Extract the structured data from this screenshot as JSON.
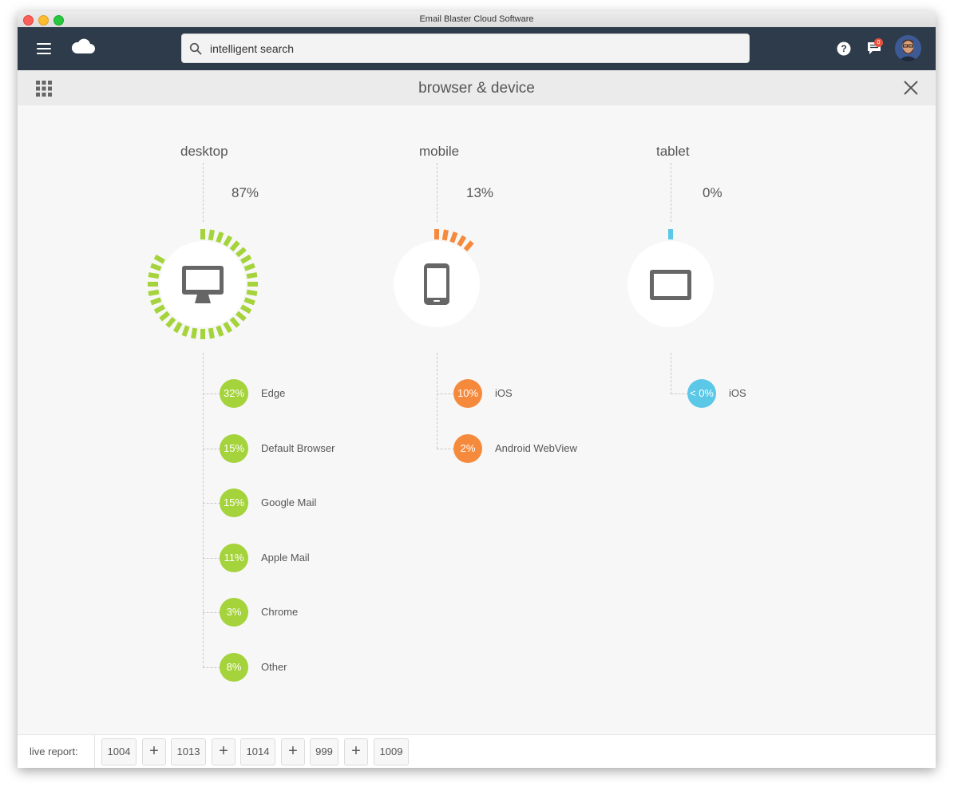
{
  "window": {
    "title": "Email Blaster Cloud Software"
  },
  "topbar": {
    "search_placeholder": "intelligent search",
    "chat_badge_count": "0"
  },
  "subheader": {
    "title": "browser & device"
  },
  "colors": {
    "desktop": "#a5d33b",
    "mobile": "#f58a3c",
    "tablet": "#5bc8e8",
    "topbar": "#2d3b4a"
  },
  "devices": [
    {
      "label": "desktop",
      "percent": "87%",
      "share": 0.87,
      "browsers": [
        {
          "pct": "32%",
          "name": "Edge"
        },
        {
          "pct": "15%",
          "name": "Default Browser"
        },
        {
          "pct": "15%",
          "name": "Google Mail"
        },
        {
          "pct": "11%",
          "name": "Apple Mail"
        },
        {
          "pct": "3%",
          "name": "Chrome"
        },
        {
          "pct": "8%",
          "name": "Other"
        }
      ]
    },
    {
      "label": "mobile",
      "percent": "13%",
      "share": 0.13,
      "browsers": [
        {
          "pct": "10%",
          "name": "iOS"
        },
        {
          "pct": "2%",
          "name": "Android WebView"
        }
      ]
    },
    {
      "label": "tablet",
      "percent": "0%",
      "share": 0.01,
      "browsers": [
        {
          "pct": "< 0%",
          "name": "iOS"
        }
      ]
    }
  ],
  "footer": {
    "label": "live report:",
    "reports": [
      "1004",
      "1013",
      "1014",
      "999",
      "1009"
    ]
  }
}
